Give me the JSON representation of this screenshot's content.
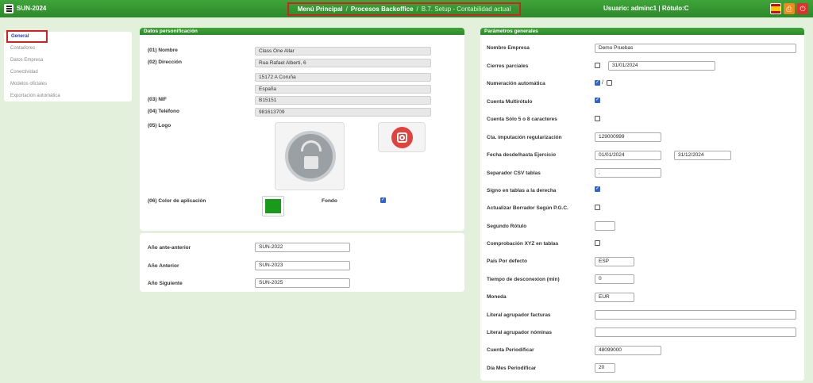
{
  "app": {
    "company_code": "SUN-2024"
  },
  "breadcrumb": {
    "item1": "Menú Principal",
    "sep1": "/",
    "item2": "Procesos Backoffice",
    "sep2": "/",
    "item3": "B.7. Setup - Contabilidad actual"
  },
  "user": {
    "info": "Usuario: adminc1 | Rótulo:C"
  },
  "sidemenu": {
    "items": [
      "General",
      "Contadores",
      "Datos Empresa",
      "Conectividad",
      "Modelos oficiales",
      "Exportación automática"
    ]
  },
  "personalizacion": {
    "header": "Datos personificación",
    "nombre_label": "(01) Nombre",
    "nombre_value": "Class One Allar",
    "direccion_label": "(02) Dirección",
    "direccion_line1": "Rua Rafael Alberti, 6",
    "direccion_line2": "15172 A Coruña",
    "direccion_line3": "España",
    "nif_label": "(03) NIF",
    "nif_value": "B15151",
    "telefono_label": "(04) Teléfono",
    "telefono_value": "981613709",
    "logo_label": "(05) Logo",
    "color_label": "(06) Color de aplicación",
    "fondo_label": "Fondo",
    "app_color": "#1a9a1a"
  },
  "years": {
    "ante_anterior_label": "Año ante-anterior",
    "ante_anterior_value": "SUN-2022",
    "anterior_label": "Año Anterior",
    "anterior_value": "SUN-2023",
    "siguiente_label": "Año Siguiente",
    "siguiente_value": "SUN-2025"
  },
  "parametros": {
    "header": "Parámetros generales",
    "nombre_empresa_label": "Nombre Empresa",
    "nombre_empresa_value": "Demo Pruebas",
    "cierres_label": "Cierres parciales",
    "cierres_date": "31/01/2024",
    "numeracion_label": "Numeración automática",
    "numeracion_slash": "/",
    "multirotulo_label": "Cuenta Multirótulo",
    "cuenta_solo_label": "Cuenta Sólo 5 o 8 caracteres",
    "cta_regularizacion_label": "Cta. imputación regularización",
    "cta_regularizacion_value": "129000999",
    "fecha_ejercicio_label": "Fecha desde/hasta Ejercicio",
    "fecha_desde": "01/01/2024",
    "fecha_hasta": "31/12/2024",
    "separador_label": "Separador CSV tablas",
    "separador_value": ";",
    "signo_label": "Signo en tablas a la derecha",
    "actualizar_label": "Actualizar Borrador Según P.G.C.",
    "segundo_rotulo_label": "Segundo Rótulo",
    "segundo_rotulo_value": "",
    "comprobacion_label": "Comprobación XYZ en tablas",
    "pais_label": "País Por defecto",
    "pais_value": "ESP",
    "tiempo_label": "Tiempo de desconexion (min)",
    "tiempo_value": "0",
    "moneda_label": "Moneda",
    "moneda_value": "EUR",
    "literal_facturas_label": "Literal agrupador facturas",
    "literal_facturas_value": "",
    "literal_nominas_label": "Literal agrupador nóminas",
    "literal_nominas_value": "",
    "cuenta_periodificar_label": "Cuenta Periodificar",
    "cuenta_periodificar_value": "48099000",
    "dia_mes_label": "Día Mes Periodificar",
    "dia_mes_value": "20"
  }
}
